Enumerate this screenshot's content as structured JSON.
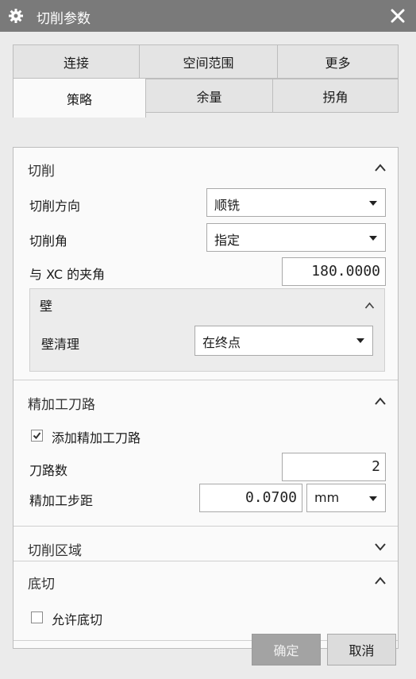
{
  "window": {
    "title": "切削参数",
    "gear_icon": "gear-icon",
    "close_icon": "close-icon"
  },
  "tabs_back": [
    "连接",
    "空间范围",
    "更多"
  ],
  "tabs_front": [
    "策略",
    "余量",
    "拐角"
  ],
  "active_tab": "策略",
  "sections": {
    "cut": {
      "title": "切削",
      "expanded": true,
      "direction_label": "切削方向",
      "direction_value": "顺铣",
      "angle_label": "切削角",
      "angle_value": "指定",
      "xc_angle_label": "与 XC 的夹角",
      "xc_angle_value": "180.0000",
      "wall": {
        "title": "壁",
        "expanded": true,
        "cleanup_label": "壁清理",
        "cleanup_value": "在终点"
      }
    },
    "finish": {
      "title": "精加工刀路",
      "expanded": true,
      "add_pass_label": "添加精加工刀路",
      "add_pass_checked": true,
      "pass_count_label": "刀路数",
      "pass_count_value": "2",
      "stepover_label": "精加工步距",
      "stepover_value": "0.0700",
      "stepover_unit": "mm"
    },
    "region": {
      "title": "切削区域",
      "expanded": false
    },
    "undercut": {
      "title": "底切",
      "expanded": true,
      "allow_label": "允许底切",
      "allow_checked": false
    }
  },
  "buttons": {
    "ok": "确定",
    "cancel": "取消",
    "ok_enabled": false
  },
  "colors": {
    "titlebar": "#7a7a7a",
    "panel": "#fafafa",
    "disabled_button": "#a3a3a3"
  }
}
